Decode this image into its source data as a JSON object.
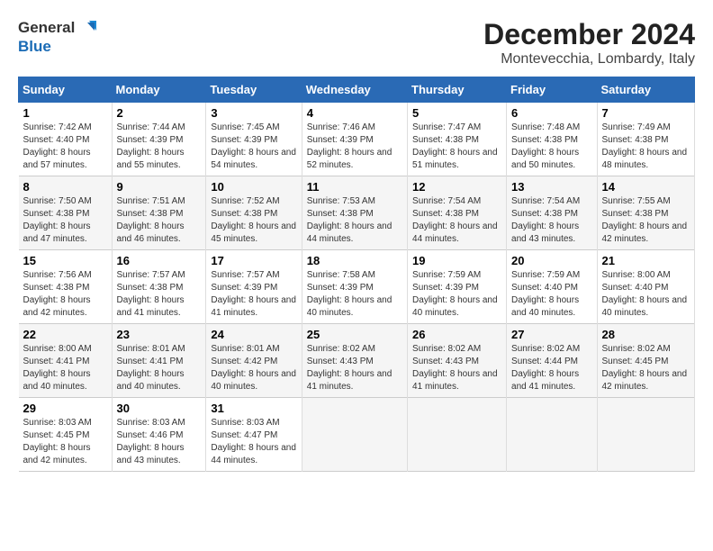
{
  "logo": {
    "line1": "General",
    "line2": "Blue"
  },
  "title": "December 2024",
  "subtitle": "Montevecchia, Lombardy, Italy",
  "weekdays": [
    "Sunday",
    "Monday",
    "Tuesday",
    "Wednesday",
    "Thursday",
    "Friday",
    "Saturday"
  ],
  "weeks": [
    [
      {
        "day": "1",
        "sunrise": "7:42 AM",
        "sunset": "4:40 PM",
        "daylight": "8 hours and 57 minutes."
      },
      {
        "day": "2",
        "sunrise": "7:44 AM",
        "sunset": "4:39 PM",
        "daylight": "8 hours and 55 minutes."
      },
      {
        "day": "3",
        "sunrise": "7:45 AM",
        "sunset": "4:39 PM",
        "daylight": "8 hours and 54 minutes."
      },
      {
        "day": "4",
        "sunrise": "7:46 AM",
        "sunset": "4:39 PM",
        "daylight": "8 hours and 52 minutes."
      },
      {
        "day": "5",
        "sunrise": "7:47 AM",
        "sunset": "4:38 PM",
        "daylight": "8 hours and 51 minutes."
      },
      {
        "day": "6",
        "sunrise": "7:48 AM",
        "sunset": "4:38 PM",
        "daylight": "8 hours and 50 minutes."
      },
      {
        "day": "7",
        "sunrise": "7:49 AM",
        "sunset": "4:38 PM",
        "daylight": "8 hours and 48 minutes."
      }
    ],
    [
      {
        "day": "8",
        "sunrise": "7:50 AM",
        "sunset": "4:38 PM",
        "daylight": "8 hours and 47 minutes."
      },
      {
        "day": "9",
        "sunrise": "7:51 AM",
        "sunset": "4:38 PM",
        "daylight": "8 hours and 46 minutes."
      },
      {
        "day": "10",
        "sunrise": "7:52 AM",
        "sunset": "4:38 PM",
        "daylight": "8 hours and 45 minutes."
      },
      {
        "day": "11",
        "sunrise": "7:53 AM",
        "sunset": "4:38 PM",
        "daylight": "8 hours and 44 minutes."
      },
      {
        "day": "12",
        "sunrise": "7:54 AM",
        "sunset": "4:38 PM",
        "daylight": "8 hours and 44 minutes."
      },
      {
        "day": "13",
        "sunrise": "7:54 AM",
        "sunset": "4:38 PM",
        "daylight": "8 hours and 43 minutes."
      },
      {
        "day": "14",
        "sunrise": "7:55 AM",
        "sunset": "4:38 PM",
        "daylight": "8 hours and 42 minutes."
      }
    ],
    [
      {
        "day": "15",
        "sunrise": "7:56 AM",
        "sunset": "4:38 PM",
        "daylight": "8 hours and 42 minutes."
      },
      {
        "day": "16",
        "sunrise": "7:57 AM",
        "sunset": "4:38 PM",
        "daylight": "8 hours and 41 minutes."
      },
      {
        "day": "17",
        "sunrise": "7:57 AM",
        "sunset": "4:39 PM",
        "daylight": "8 hours and 41 minutes."
      },
      {
        "day": "18",
        "sunrise": "7:58 AM",
        "sunset": "4:39 PM",
        "daylight": "8 hours and 40 minutes."
      },
      {
        "day": "19",
        "sunrise": "7:59 AM",
        "sunset": "4:39 PM",
        "daylight": "8 hours and 40 minutes."
      },
      {
        "day": "20",
        "sunrise": "7:59 AM",
        "sunset": "4:40 PM",
        "daylight": "8 hours and 40 minutes."
      },
      {
        "day": "21",
        "sunrise": "8:00 AM",
        "sunset": "4:40 PM",
        "daylight": "8 hours and 40 minutes."
      }
    ],
    [
      {
        "day": "22",
        "sunrise": "8:00 AM",
        "sunset": "4:41 PM",
        "daylight": "8 hours and 40 minutes."
      },
      {
        "day": "23",
        "sunrise": "8:01 AM",
        "sunset": "4:41 PM",
        "daylight": "8 hours and 40 minutes."
      },
      {
        "day": "24",
        "sunrise": "8:01 AM",
        "sunset": "4:42 PM",
        "daylight": "8 hours and 40 minutes."
      },
      {
        "day": "25",
        "sunrise": "8:02 AM",
        "sunset": "4:43 PM",
        "daylight": "8 hours and 41 minutes."
      },
      {
        "day": "26",
        "sunrise": "8:02 AM",
        "sunset": "4:43 PM",
        "daylight": "8 hours and 41 minutes."
      },
      {
        "day": "27",
        "sunrise": "8:02 AM",
        "sunset": "4:44 PM",
        "daylight": "8 hours and 41 minutes."
      },
      {
        "day": "28",
        "sunrise": "8:02 AM",
        "sunset": "4:45 PM",
        "daylight": "8 hours and 42 minutes."
      }
    ],
    [
      {
        "day": "29",
        "sunrise": "8:03 AM",
        "sunset": "4:45 PM",
        "daylight": "8 hours and 42 minutes."
      },
      {
        "day": "30",
        "sunrise": "8:03 AM",
        "sunset": "4:46 PM",
        "daylight": "8 hours and 43 minutes."
      },
      {
        "day": "31",
        "sunrise": "8:03 AM",
        "sunset": "4:47 PM",
        "daylight": "8 hours and 44 minutes."
      },
      null,
      null,
      null,
      null
    ]
  ]
}
